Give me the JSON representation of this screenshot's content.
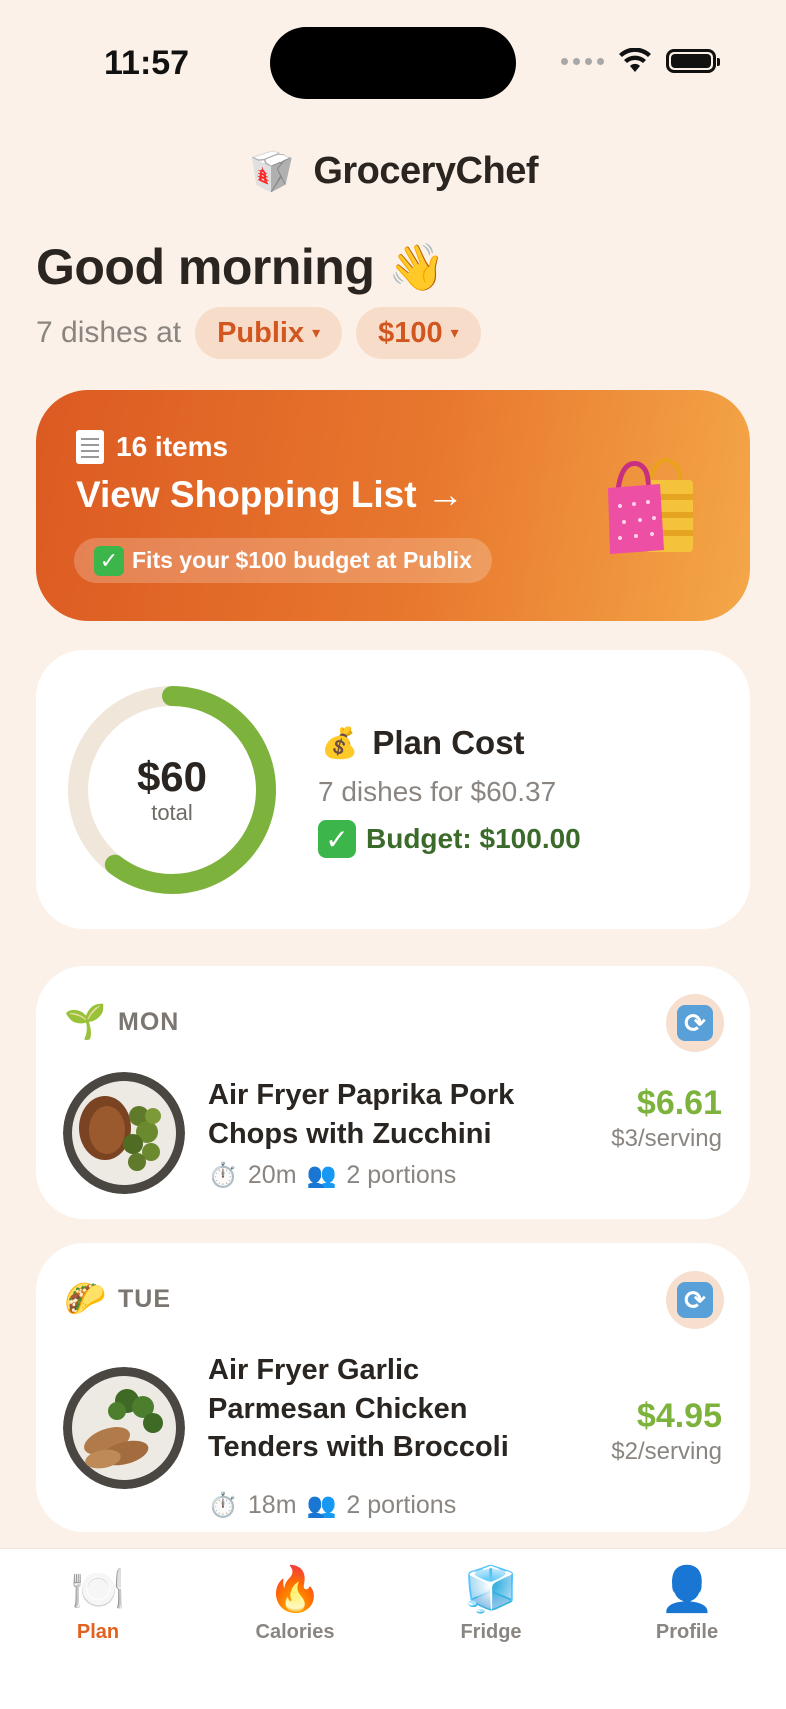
{
  "status_bar": {
    "time": "11:57"
  },
  "header": {
    "app_name": "GroceryChef",
    "logo_emoji": "🥡"
  },
  "greeting": {
    "text": "Good morning",
    "emoji": "👋"
  },
  "subline": {
    "text": "7 dishes at",
    "store": "Publix",
    "budget": "$100",
    "caret": "▾"
  },
  "shopping_banner": {
    "items": "16 items",
    "title": "View Shopping List →",
    "fit_text": "Fits your $100 budget at Publix",
    "bag_icon": "shopping-bags-icon"
  },
  "plan_cost": {
    "amount": "$60",
    "amount_label": "total",
    "progress_fraction": 0.6037,
    "title": "Plan Cost",
    "subtitle": "7 dishes for $60.37",
    "budget": "Budget: $100.00"
  },
  "dishes": [
    {
      "day": "MON",
      "day_icon": "🌱",
      "name": "Air Fryer Paprika Pork Chops with Zucchini",
      "time": "20m",
      "portions": "2 portions",
      "price": "$6.61",
      "per_serving": "$3/serving"
    },
    {
      "day": "TUE",
      "day_icon": "🌮",
      "name": "Air Fryer Garlic Parmesan Chicken Tenders with Broccoli",
      "time": "18m",
      "portions": "2 portions",
      "price": "$4.95",
      "per_serving": "$2/serving"
    }
  ],
  "tabs": [
    {
      "label": "Plan",
      "icon": "🍽️",
      "active": true
    },
    {
      "label": "Calories",
      "icon": "🔥",
      "active": false
    },
    {
      "label": "Fridge",
      "icon": "🧊",
      "active": false
    },
    {
      "label": "Profile",
      "icon": "👤",
      "active": false
    }
  ],
  "colors": {
    "accent": "#E2611E",
    "background": "#FBF1E8",
    "price_green": "#7DB33C",
    "ring_green": "#7DB33C",
    "ring_track": "#F0E6DA"
  }
}
